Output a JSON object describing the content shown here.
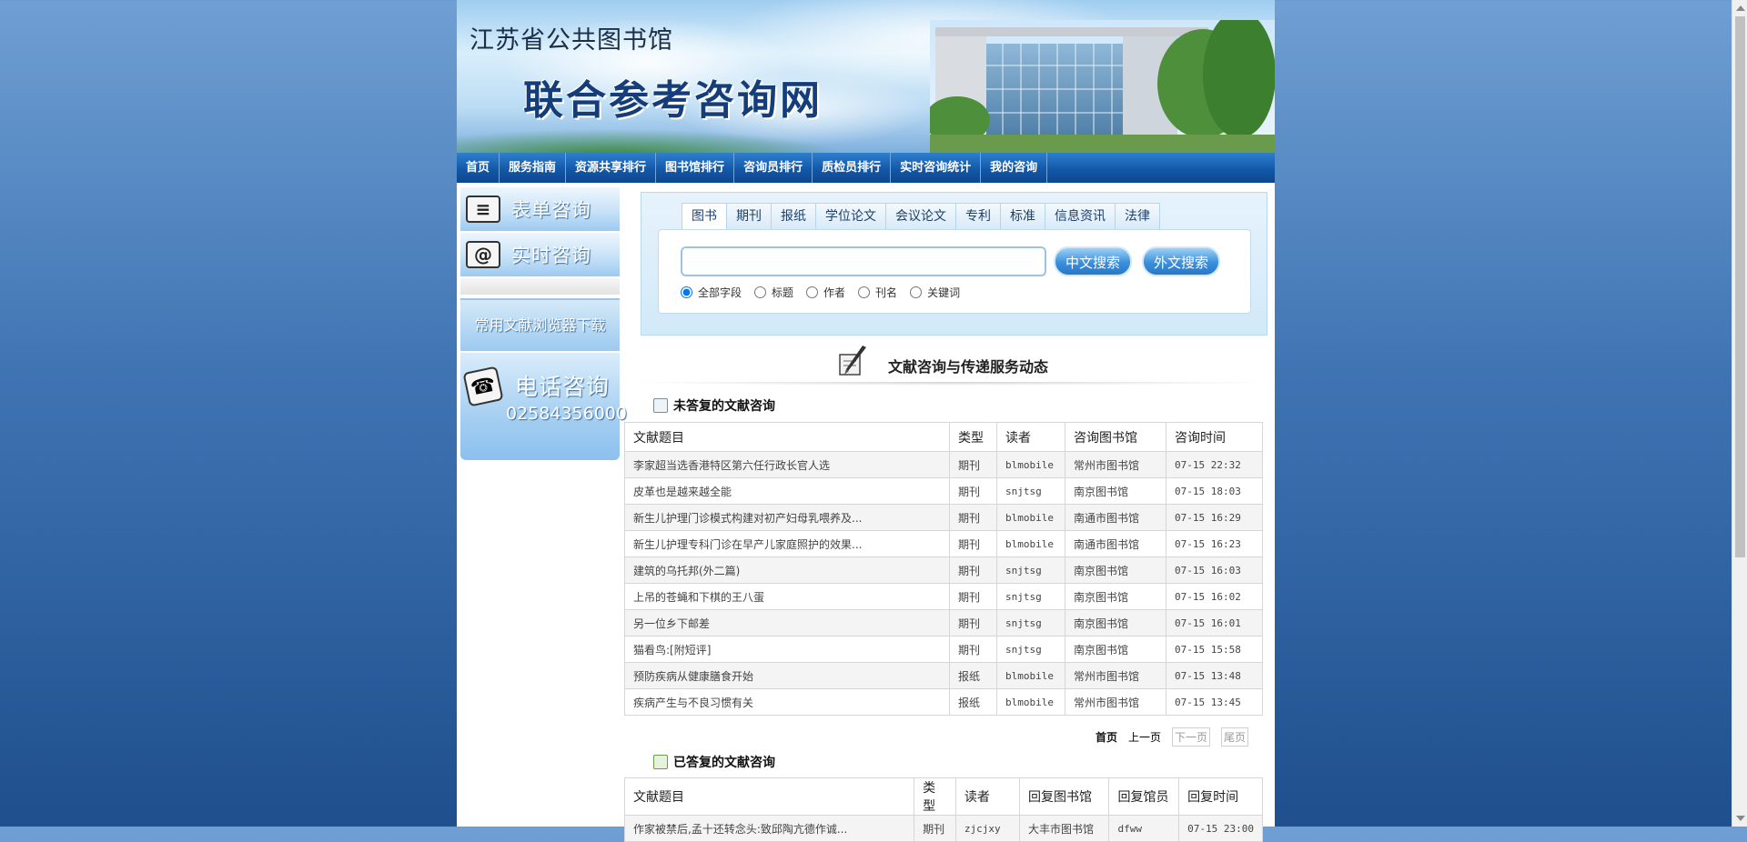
{
  "banner": {
    "title_line1": "江苏省公共图书馆",
    "title_line2": "联合参考咨询网"
  },
  "nav": {
    "items": [
      "首页",
      "服务指南",
      "资源共享排行",
      "图书馆排行",
      "咨询员排行",
      "质检员排行",
      "实时咨询统计",
      "我的咨询"
    ]
  },
  "left": {
    "form_consult": "表单咨询",
    "live_consult": "实时咨询",
    "browser_download": "常用文献浏览器下载",
    "phone_title": "电话咨询",
    "phone_number": "02584356000"
  },
  "search": {
    "tabs": [
      "图书",
      "期刊",
      "报纸",
      "学位论文",
      "会议论文",
      "专利",
      "标准",
      "信息资讯",
      "法律"
    ],
    "active_tab": "图书",
    "query_value": "",
    "btn_cn": "中文搜索",
    "btn_foreign": "外文搜索",
    "fields": [
      "全部字段",
      "标题",
      "作者",
      "刊名",
      "关键词"
    ],
    "selected_field": "全部字段"
  },
  "dynamics": {
    "title": "文献咨询与传递服务动态"
  },
  "unanswered": {
    "title": "未答复的文献咨询",
    "headers": [
      "文献题目",
      "类型",
      "读者",
      "咨询图书馆",
      "咨询时间"
    ],
    "rows": [
      [
        "李家超当选香港特区第六任行政长官人选",
        "期刊",
        "blmobile",
        "常州市图书馆",
        "07-15 22:32"
      ],
      [
        "皮革也是越来越全能",
        "期刊",
        "snjtsg",
        "南京图书馆",
        "07-15 18:03"
      ],
      [
        "新生儿护理门诊模式构建对初产妇母乳喂养及...",
        "期刊",
        "blmobile",
        "南通市图书馆",
        "07-15 16:29"
      ],
      [
        "新生儿护理专科门诊在早产儿家庭照护的效果...",
        "期刊",
        "blmobile",
        "南通市图书馆",
        "07-15 16:23"
      ],
      [
        "建筑的乌托邦(外二篇)",
        "期刊",
        "snjtsg",
        "南京图书馆",
        "07-15 16:03"
      ],
      [
        "上吊的苍蝇和下棋的王八蛋",
        "期刊",
        "snjtsg",
        "南京图书馆",
        "07-15 16:02"
      ],
      [
        "另一位乡下邮差",
        "期刊",
        "snjtsg",
        "南京图书馆",
        "07-15 16:01"
      ],
      [
        "猫看鸟:[附短评]",
        "期刊",
        "snjtsg",
        "南京图书馆",
        "07-15 15:58"
      ],
      [
        "预防疾病从健康膳食开始",
        "报纸",
        "blmobile",
        "常州市图书馆",
        "07-15 13:48"
      ],
      [
        "疾病产生与不良习惯有关",
        "报纸",
        "blmobile",
        "常州市图书馆",
        "07-15 13:45"
      ]
    ]
  },
  "pager": {
    "first": "首页",
    "prev": "上一页",
    "next": "下一页",
    "last": "尾页"
  },
  "answered": {
    "title": "已答复的文献咨询",
    "headers": [
      "文献题目",
      "类型",
      "读者",
      "回复图书馆",
      "回复馆员",
      "回复时间"
    ],
    "rows": [
      [
        "作家被禁后,孟十还转念头:致邱陶亢德作诚...",
        "期刊",
        "zjcjxy",
        "大丰市图书馆",
        "dfww",
        "07-15 23:00"
      ]
    ]
  }
}
